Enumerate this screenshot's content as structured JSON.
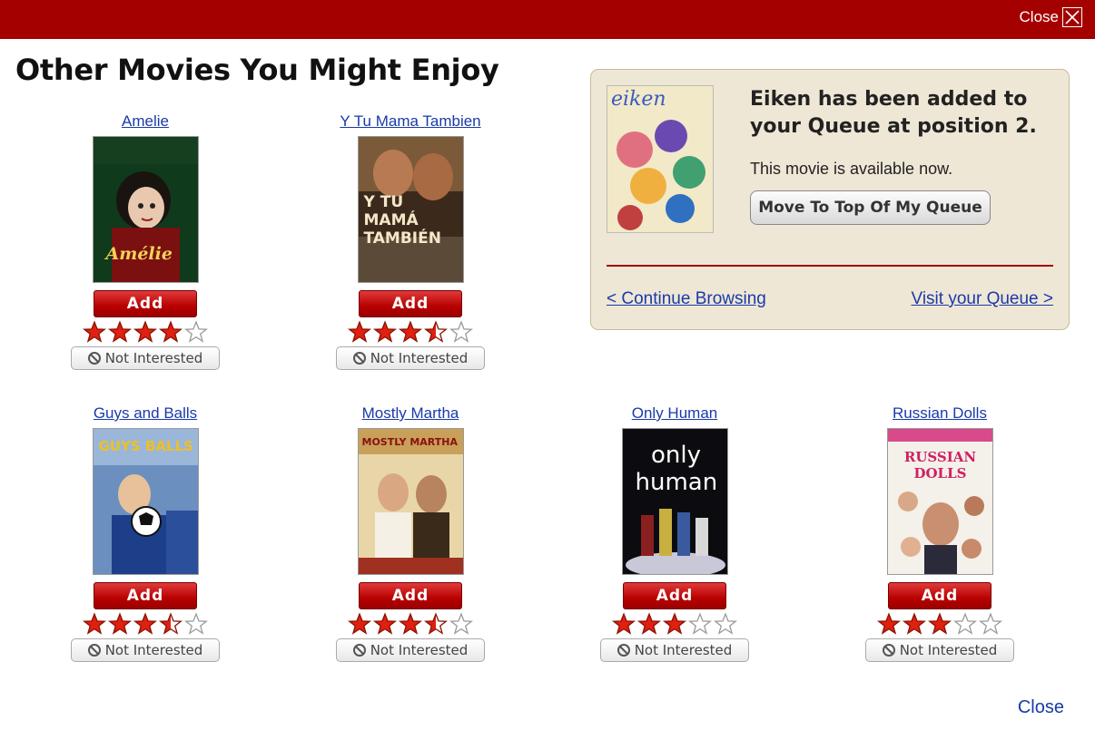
{
  "topbar": {
    "close_label": "Close"
  },
  "heading": "Other Movies You Might Enjoy",
  "queue": {
    "message": "Eiken has been added to your Queue at position 2.",
    "availability": "This movie is available now.",
    "move_button": "Move To Top Of My Queue",
    "continue_link": "< Continue Browsing",
    "visit_link": "Visit your Queue >",
    "poster_title": "eiken"
  },
  "movies": [
    {
      "title": "Amelie",
      "rating": 4,
      "add_label": "Add",
      "not_interested_label": "Not Interested"
    },
    {
      "title": "Y Tu Mama Tambien",
      "rating": 3.5,
      "add_label": "Add",
      "not_interested_label": "Not Interested"
    },
    {
      "title": "Guys and Balls",
      "rating": 3.5,
      "add_label": "Add",
      "not_interested_label": "Not Interested"
    },
    {
      "title": "Mostly Martha",
      "rating": 3.5,
      "add_label": "Add",
      "not_interested_label": "Not Interested"
    },
    {
      "title": "Only Human",
      "rating": 3,
      "add_label": "Add",
      "not_interested_label": "Not Interested"
    },
    {
      "title": "Russian Dolls",
      "rating": 3,
      "add_label": "Add",
      "not_interested_label": "Not Interested"
    }
  ],
  "posters": {
    "amelie": "Amélie",
    "ytumama": "Y TU MAMÁ TAMBIÉN",
    "guys_top": "GUYS BALLS",
    "martha": "MOSTLY MARTHA",
    "only_human": "only human",
    "dolls": "RUSSIAN DOLLS"
  },
  "bottom": {
    "close_label": "Close"
  },
  "colors": {
    "brand_red": "#a50000",
    "link_blue": "#1a3aa8",
    "star_red": "#e02010",
    "panel_bg": "#efe7d6"
  },
  "icons": {
    "close": "close-box-icon",
    "star": "star-icon",
    "not_interested": "no-entry-icon"
  }
}
